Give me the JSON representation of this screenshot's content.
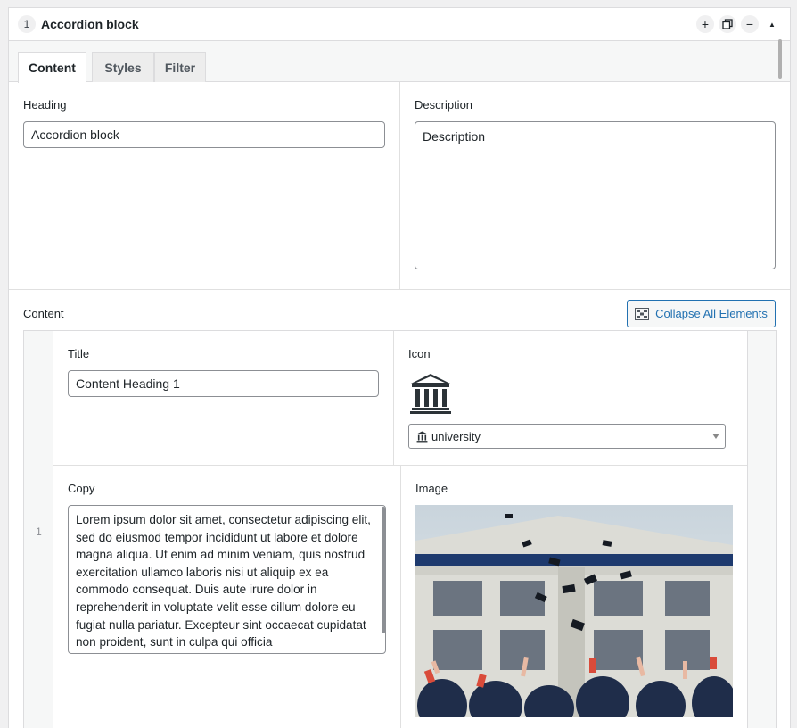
{
  "block": {
    "index": "1",
    "title": "Accordion block"
  },
  "header_actions": [
    {
      "name": "add-icon",
      "glyph": "+"
    },
    {
      "name": "duplicate-icon",
      "glyph": "⧉"
    },
    {
      "name": "remove-icon",
      "glyph": "−"
    },
    {
      "name": "collapse-arrow-icon",
      "glyph": "▲"
    }
  ],
  "tabs": [
    {
      "label": "Content",
      "active": true
    },
    {
      "label": "Styles",
      "active": false
    },
    {
      "label": "Filter",
      "active": false
    }
  ],
  "fields": {
    "heading": {
      "label": "Heading",
      "value": "Accordion block"
    },
    "description": {
      "label": "Description",
      "value": "Description"
    }
  },
  "content": {
    "label": "Content",
    "collapse_button": "Collapse All Elements",
    "rows": [
      {
        "number": "1",
        "title_label": "Title",
        "title_value": "Content Heading 1",
        "icon_label": "Icon",
        "icon_name": "university-icon",
        "icon_select_value": "university",
        "copy_label": "Copy",
        "copy_value": "Lorem ipsum dolor sit amet, consectetur adipiscing elit, sed do eiusmod tempor incididunt ut labore et dolore magna aliqua. Ut enim ad minim veniam, quis nostrud exercitation ullamco laboris nisi ut aliquip ex ea commodo consequat. Duis aute irure dolor in reprehenderit in voluptate velit esse cillum dolore eu fugiat nulla pariatur. Excepteur sint occaecat cupidatat non proident, sunt in culpa qui officia",
        "image_label": "Image"
      }
    ]
  },
  "colors": {
    "accent": "#2271b1",
    "border": "#dcdcde",
    "input_border": "#8c8f94"
  }
}
